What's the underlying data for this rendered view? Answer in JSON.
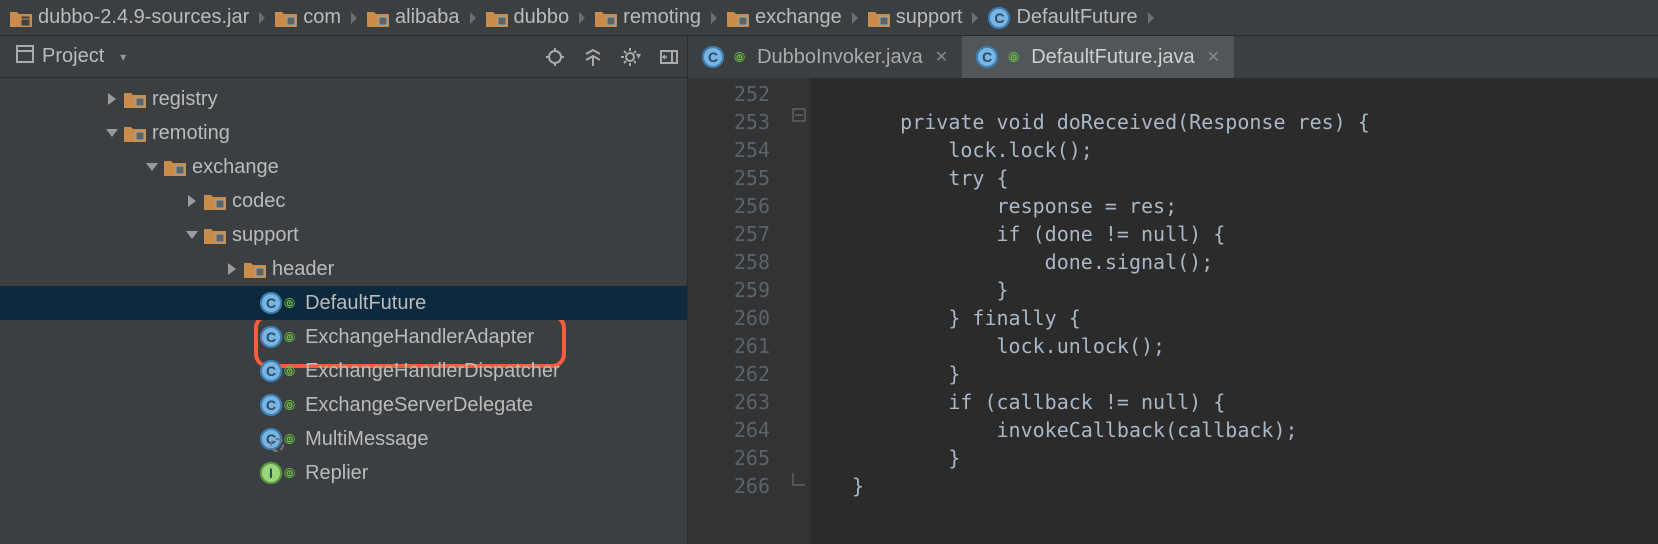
{
  "breadcrumbs": [
    {
      "label": "dubbo-2.4.9-sources.jar",
      "type": "jar"
    },
    {
      "label": "com",
      "type": "pkg"
    },
    {
      "label": "alibaba",
      "type": "pkg"
    },
    {
      "label": "dubbo",
      "type": "pkg"
    },
    {
      "label": "remoting",
      "type": "pkg"
    },
    {
      "label": "exchange",
      "type": "pkg"
    },
    {
      "label": "support",
      "type": "pkg"
    },
    {
      "label": "DefaultFuture",
      "type": "class"
    }
  ],
  "projectPanel": {
    "title": "Project"
  },
  "tree": {
    "rows": [
      {
        "indent": 108,
        "twisty": "closed",
        "icon": "pkg",
        "label": "registry"
      },
      {
        "indent": 108,
        "twisty": "open",
        "icon": "pkg",
        "label": "remoting"
      },
      {
        "indent": 148,
        "twisty": "open",
        "icon": "pkg",
        "label": "exchange"
      },
      {
        "indent": 188,
        "twisty": "closed",
        "icon": "pkg",
        "label": "codec"
      },
      {
        "indent": 188,
        "twisty": "open",
        "icon": "pkg",
        "label": "support"
      },
      {
        "indent": 228,
        "twisty": "closed",
        "icon": "pkg",
        "label": "header"
      },
      {
        "indent": 260,
        "twisty": "none",
        "icon": "class",
        "pub": true,
        "label": "DefaultFuture",
        "selected": true
      },
      {
        "indent": 260,
        "twisty": "none",
        "icon": "class",
        "pub": true,
        "label": "ExchangeHandlerAdapter"
      },
      {
        "indent": 260,
        "twisty": "none",
        "icon": "class",
        "pub": true,
        "label": "ExchangeHandlerDispatcher"
      },
      {
        "indent": 260,
        "twisty": "none",
        "icon": "class",
        "pub": true,
        "label": "ExchangeServerDelegate"
      },
      {
        "indent": 260,
        "twisty": "none",
        "icon": "abs",
        "pub": true,
        "label": "MultiMessage"
      },
      {
        "indent": 260,
        "twisty": "none",
        "icon": "iface",
        "pub": true,
        "label": "Replier"
      }
    ]
  },
  "tabs": [
    {
      "label": "DubboInvoker.java",
      "active": false
    },
    {
      "label": "DefaultFuture.java",
      "active": true
    }
  ],
  "code": {
    "start": 252,
    "tokens": [
      [],
      [
        {
          "t": "kw",
          "v": "private"
        },
        {
          "t": "sp",
          "v": " "
        },
        {
          "t": "kw",
          "v": "void"
        },
        {
          "t": "sp",
          "v": " "
        },
        {
          "t": "method-decl",
          "v": "doReceived"
        },
        {
          "t": "punc",
          "v": "(Response res) {"
        }
      ],
      [
        {
          "t": "pad",
          "v": 4
        },
        {
          "t": "ident",
          "v": "lock.lock();"
        }
      ],
      [
        {
          "t": "pad",
          "v": 4
        },
        {
          "t": "kw",
          "v": "try"
        },
        {
          "t": "sp",
          "v": " "
        },
        {
          "t": "punc",
          "v": "{"
        }
      ],
      [
        {
          "t": "pad",
          "v": 8
        },
        {
          "t": "ident",
          "v": "response = res;"
        }
      ],
      [
        {
          "t": "pad",
          "v": 8
        },
        {
          "t": "kw",
          "v": "if"
        },
        {
          "t": "sp",
          "v": " "
        },
        {
          "t": "punc",
          "v": "(done != "
        },
        {
          "t": "kw",
          "v": "null"
        },
        {
          "t": "punc",
          "v": ") {"
        }
      ],
      [
        {
          "t": "pad",
          "v": 12
        },
        {
          "t": "ident",
          "v": "done.signal();"
        }
      ],
      [
        {
          "t": "pad",
          "v": 8
        },
        {
          "t": "punc",
          "v": "}"
        }
      ],
      [
        {
          "t": "pad",
          "v": 4
        },
        {
          "t": "punc",
          "v": "} "
        },
        {
          "t": "kw",
          "v": "finally"
        },
        {
          "t": "sp",
          "v": " "
        },
        {
          "t": "punc",
          "v": "{"
        }
      ],
      [
        {
          "t": "pad",
          "v": 8
        },
        {
          "t": "ident",
          "v": "lock.unlock();"
        }
      ],
      [
        {
          "t": "pad",
          "v": 4
        },
        {
          "t": "punc",
          "v": "}"
        }
      ],
      [
        {
          "t": "pad",
          "v": 4
        },
        {
          "t": "kw",
          "v": "if"
        },
        {
          "t": "sp",
          "v": " "
        },
        {
          "t": "punc",
          "v": "(callback != "
        },
        {
          "t": "kw",
          "v": "null"
        },
        {
          "t": "punc",
          "v": ") {"
        }
      ],
      [
        {
          "t": "pad",
          "v": 8
        },
        {
          "t": "ident",
          "v": "invokeCallback(callback);"
        }
      ],
      [
        {
          "t": "pad",
          "v": 4
        },
        {
          "t": "punc",
          "v": "}"
        }
      ],
      [
        {
          "t": "punc",
          "v": "}"
        }
      ]
    ]
  }
}
